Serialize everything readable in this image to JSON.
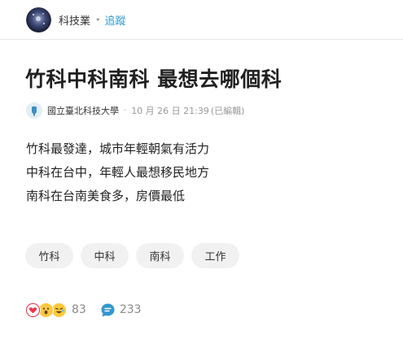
{
  "board": {
    "name": "科技業",
    "follow_label": "追蹤"
  },
  "post": {
    "title": "竹科中科南科 最想去哪個科",
    "author_school": "國立臺北科技大學",
    "timestamp": "10 月 26 日 21:39",
    "edited_label": "(已編輯)",
    "body_lines": [
      "竹科最發達，城市年輕朝氣有活力",
      "中科在台中，年輕人最想移民地方",
      "南科在台南美食多，房價最低"
    ],
    "tags": [
      "竹科",
      "中科",
      "南科",
      "工作"
    ]
  },
  "stats": {
    "reaction_count": "83",
    "comment_count": "233"
  },
  "colors": {
    "accent": "#3397cf",
    "heart": "#e8394f",
    "comment": "#3397cf"
  },
  "icons": [
    "board-avatar",
    "school-icon",
    "heart-reaction-icon",
    "surprised-reaction-icon",
    "laugh-reaction-icon",
    "comment-icon"
  ]
}
